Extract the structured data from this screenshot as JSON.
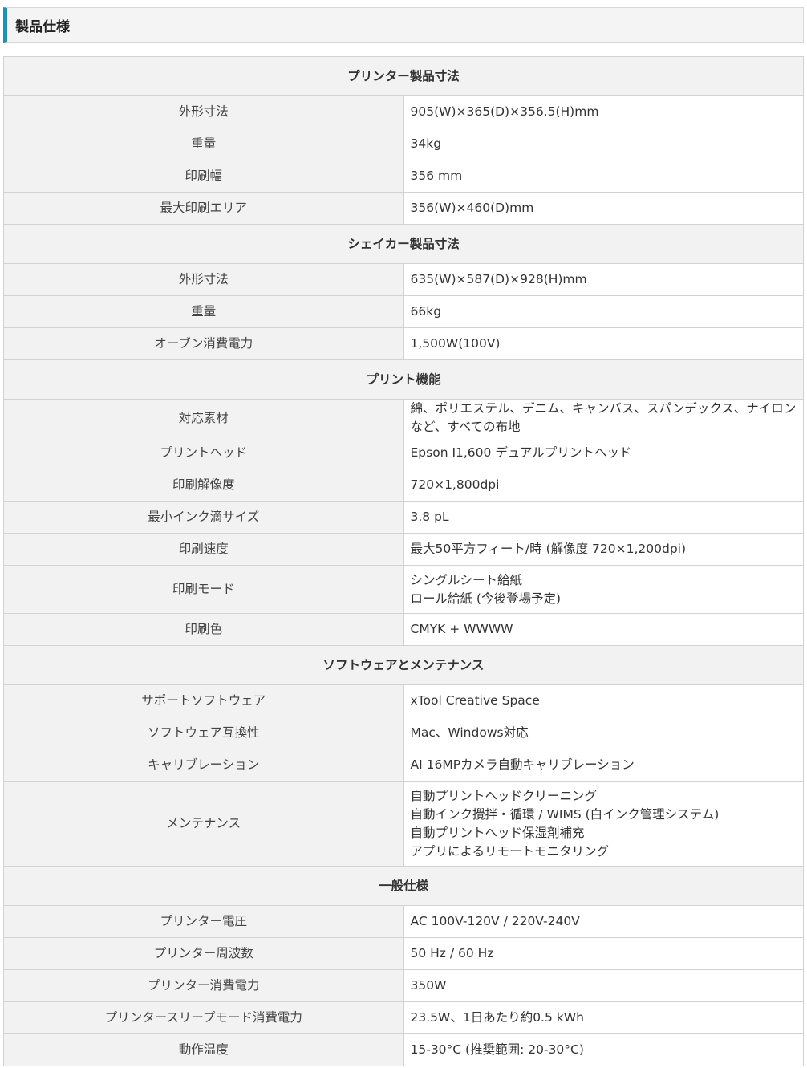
{
  "page_title": "製品仕様",
  "sections": [
    {
      "title": "プリンター製品寸法",
      "rows": [
        {
          "label": "外形寸法",
          "lines": [
            "905(W)×365(D)×356.5(H)mm"
          ]
        },
        {
          "label": "重量",
          "lines": [
            "34kg"
          ]
        },
        {
          "label": "印刷幅",
          "lines": [
            "356 mm"
          ]
        },
        {
          "label": "最大印刷エリア",
          "lines": [
            "356(W)×460(D)mm"
          ]
        }
      ]
    },
    {
      "title": "シェイカー製品寸法",
      "rows": [
        {
          "label": "外形寸法",
          "lines": [
            "635(W)×587(D)×928(H)mm"
          ]
        },
        {
          "label": "重量",
          "lines": [
            "66kg"
          ]
        },
        {
          "label": "オーブン消費電力",
          "lines": [
            "1,500W(100V)"
          ]
        }
      ]
    },
    {
      "title": "プリント機能",
      "rows": [
        {
          "label": "対応素材",
          "lines": [
            "綿、ポリエステル、デニム、キャンバス、スパンデックス、ナイロンなど、すべての布地"
          ]
        },
        {
          "label": "プリントヘッド",
          "lines": [
            "Epson I1,600 デュアルプリントヘッド"
          ]
        },
        {
          "label": "印刷解像度",
          "lines": [
            "720×1,800dpi"
          ]
        },
        {
          "label": "最小インク滴サイズ",
          "lines": [
            "3.8 pL"
          ]
        },
        {
          "label": "印刷速度",
          "lines": [
            "最大50平方フィート/時 (解像度 720×1,200dpi)"
          ]
        },
        {
          "label": "印刷モード",
          "lines": [
            "シングルシート給紙",
            "ロール給紙 (今後登場予定)"
          ]
        },
        {
          "label": "印刷色",
          "lines": [
            "CMYK + WWWW"
          ]
        }
      ]
    },
    {
      "title": "ソフトウェアとメンテナンス",
      "rows": [
        {
          "label": "サポートソフトウェア",
          "lines": [
            "xTool Creative Space"
          ]
        },
        {
          "label": "ソフトウェア互換性",
          "lines": [
            "Mac、Windows対応"
          ]
        },
        {
          "label": "キャリブレーション",
          "lines": [
            "AI 16MPカメラ自動キャリブレーション"
          ]
        },
        {
          "label": "メンテナンス",
          "lines": [
            "自動プリントヘッドクリーニング",
            "自動インク攪拌・循環 / WIMS (白インク管理システム)",
            "自動プリントヘッド保湿剤補充",
            "アプリによるリモートモニタリング"
          ]
        }
      ]
    },
    {
      "title": "一般仕様",
      "rows": [
        {
          "label": "プリンター電圧",
          "lines": [
            "AC 100V-120V / 220V-240V"
          ]
        },
        {
          "label": "プリンター周波数",
          "lines": [
            "50 Hz / 60 Hz"
          ]
        },
        {
          "label": "プリンター消費電力",
          "lines": [
            "350W"
          ]
        },
        {
          "label": "プリンタースリープモード消費電力",
          "lines": [
            "23.5W、1日あたり約0.5 kWh"
          ]
        },
        {
          "label": "動作温度",
          "lines": [
            "15-30°C (推奨範囲: 20-30°C)"
          ]
        }
      ]
    }
  ]
}
